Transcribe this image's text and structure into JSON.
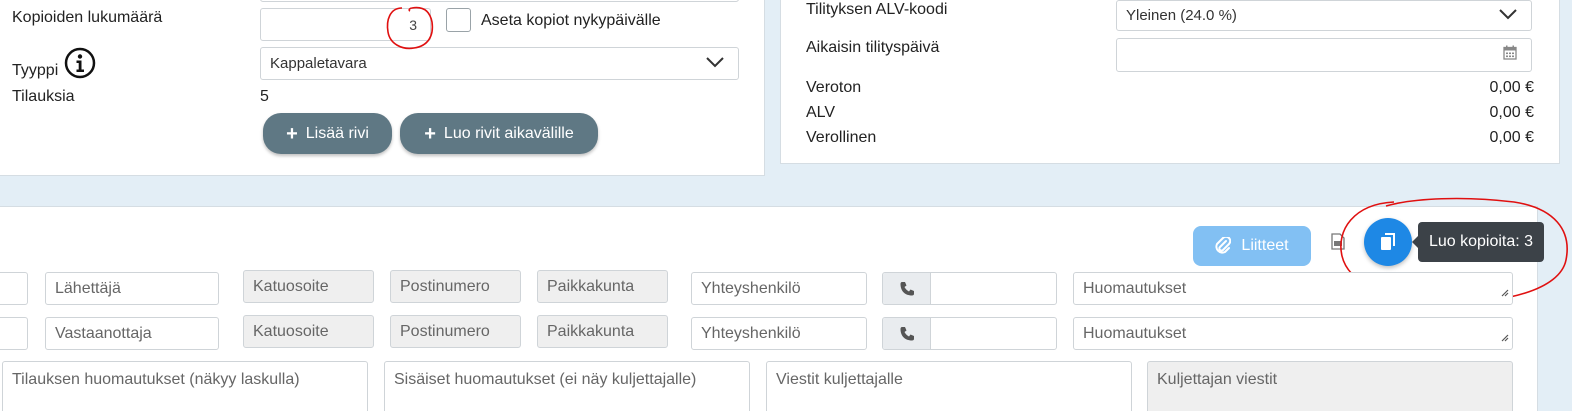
{
  "order": {
    "copies_label": "Kopioiden lukumäärä",
    "copies_value": "3",
    "set_copies_today_label": "Aseta kopiot nykypäivälle",
    "type_label": "Tyyppi",
    "type_value": "Kappaletavara",
    "orders_label": "Tilauksia",
    "orders_value": "5",
    "add_row_label": "Lisää rivi",
    "create_rows_label": "Luo rivit aikavälille"
  },
  "billing": {
    "vat_code_label": "Tilityksen ALV-koodi",
    "vat_code_value": "Yleinen (24.0 %)",
    "earliest_date_label": "Aikaisin tilityspäivä",
    "net_label": "Veroton",
    "net_value": "0,00 €",
    "vat_label": "ALV",
    "vat_value": "0,00 €",
    "gross_label": "Verollinen",
    "gross_value": "0,00 €"
  },
  "toolbar": {
    "attachments_label": "Liitteet",
    "copy_tooltip": "Luo kopioita: 3"
  },
  "sender": {
    "name_ph": "Lähettäjä",
    "street_ph": "Katuosoite",
    "postal_ph": "Postinumero",
    "city_ph": "Paikkakunta",
    "contact_ph": "Yhteyshenkilö",
    "notes_ph": "Huomautukset"
  },
  "receiver": {
    "name_ph": "Vastaanottaja",
    "street_ph": "Katuosoite",
    "postal_ph": "Postinumero",
    "city_ph": "Paikkakunta",
    "contact_ph": "Yhteyshenkilö",
    "notes_ph": "Huomautukset"
  },
  "notes": {
    "order_notes_ph": "Tilauksen huomautukset (näkyy laskulla)",
    "internal_notes_ph": "Sisäiset huomautukset (ei näy kuljettajalle)",
    "driver_messages_ph": "Viestit kuljettajalle",
    "driver_replies_ph": "Kuljettajan viestit"
  },
  "colors": {
    "annotation": "#e01010",
    "primary": "#1e88e5",
    "dark_button": "#5f7884"
  }
}
